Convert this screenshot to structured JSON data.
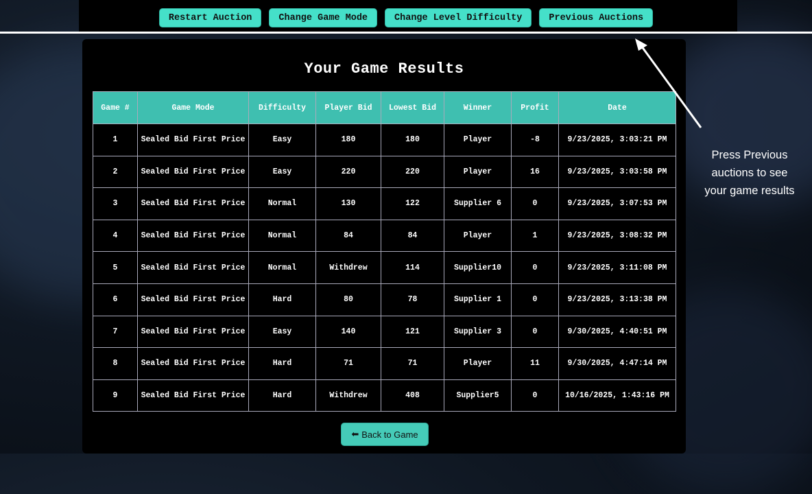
{
  "nav": {
    "buttons": [
      "Restart Auction",
      "Change Game Mode",
      "Change Level Difficulty",
      "Previous Auctions"
    ]
  },
  "results": {
    "title": "Your Game Results",
    "columns": [
      "Game #",
      "Game Mode",
      "Difficulty",
      "Player Bid",
      "Lowest Bid",
      "Winner",
      "Profit",
      "Date"
    ],
    "rows": [
      [
        "1",
        "Sealed Bid First Price",
        "Easy",
        "180",
        "180",
        "Player",
        "-8",
        "9/23/2025, 3:03:21 PM"
      ],
      [
        "2",
        "Sealed Bid First Price",
        "Easy",
        "220",
        "220",
        "Player",
        "16",
        "9/23/2025, 3:03:58 PM"
      ],
      [
        "3",
        "Sealed Bid First Price",
        "Normal",
        "130",
        "122",
        "Supplier 6",
        "0",
        "9/23/2025, 3:07:53 PM"
      ],
      [
        "4",
        "Sealed Bid First Price",
        "Normal",
        "84",
        "84",
        "Player",
        "1",
        "9/23/2025, 3:08:32 PM"
      ],
      [
        "5",
        "Sealed Bid First Price",
        "Normal",
        "Withdrew",
        "114",
        "Supplier10",
        "0",
        "9/23/2025, 3:11:08 PM"
      ],
      [
        "6",
        "Sealed Bid First Price",
        "Hard",
        "80",
        "78",
        "Supplier 1",
        "0",
        "9/23/2025, 3:13:38 PM"
      ],
      [
        "7",
        "Sealed Bid First Price",
        "Easy",
        "140",
        "121",
        "Supplier 3",
        "0",
        "9/30/2025, 4:40:51 PM"
      ],
      [
        "8",
        "Sealed Bid First Price",
        "Hard",
        "71",
        "71",
        "Player",
        "11",
        "9/30/2025, 4:47:14 PM"
      ],
      [
        "9",
        "Sealed Bid First Price",
        "Hard",
        "Withdrew",
        "408",
        "Supplier5",
        "0",
        "10/16/2025, 1:43:16 PM"
      ]
    ],
    "back_button": {
      "icon": "left-arrow-icon",
      "label": "Back to Game"
    }
  },
  "annotation": {
    "text": "Press Previous auctions to see your game results"
  },
  "colors": {
    "accent": "#45e0c9",
    "header": "#3fbfb0",
    "panel": "#000000"
  }
}
